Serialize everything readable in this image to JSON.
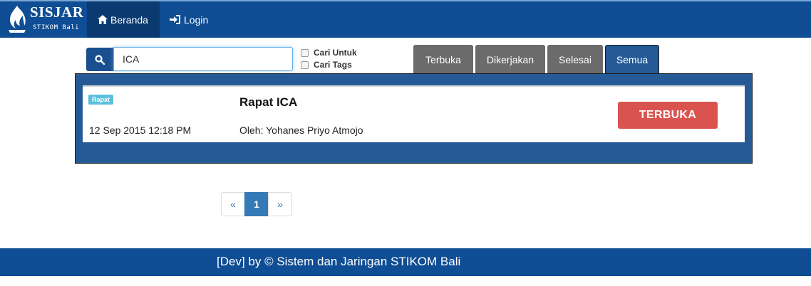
{
  "brand": {
    "title": "SISJAR",
    "subtitle": "STIKOM Bali"
  },
  "nav": {
    "home_label": "Beranda",
    "login_label": "Login"
  },
  "search": {
    "value": "ICA",
    "placeholder": ""
  },
  "filters": {
    "cari_untuk": "Cari Untuk",
    "cari_tags": "Cari Tags"
  },
  "tabs": [
    {
      "label": "Terbuka"
    },
    {
      "label": "Dikerjakan"
    },
    {
      "label": "Selesai"
    },
    {
      "label": "Semua",
      "active": true
    }
  ],
  "items": [
    {
      "badge": "Rapat",
      "date": "12 Sep 2015 12:18 PM",
      "title": "Rapat ICA",
      "author": "Oleh: Yohanes Priyo Atmojo",
      "status": "TERBUKA"
    }
  ],
  "pagination": {
    "prev": "«",
    "current": "1",
    "next": "»"
  },
  "footer": {
    "text": "[Dev] by © Sistem dan Jaringan STIKOM Bali"
  },
  "colors": {
    "navbar": "#0f4d94",
    "panel": "#255a97",
    "status_open": "#d9534f",
    "badge": "#5bc0de"
  }
}
